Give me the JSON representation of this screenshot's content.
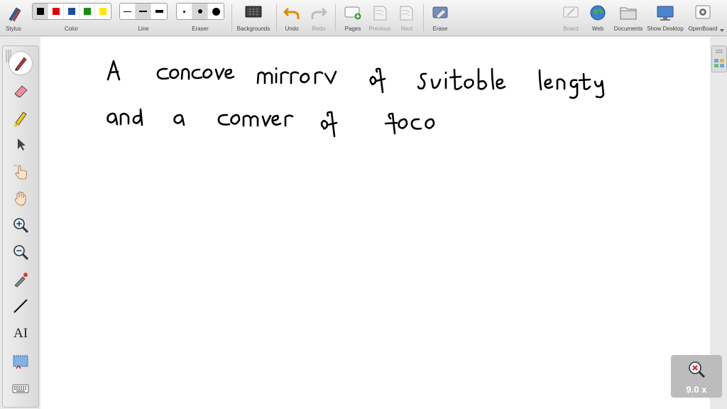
{
  "toolbar": {
    "stylus_label": "Stylus",
    "color_label": "Color",
    "line_label": "Line",
    "eraser_label": "Eraser",
    "backgrounds_label": "Backgrounds",
    "undo_label": "Undo",
    "redo_label": "Redo",
    "pages_label": "Pages",
    "previous_label": "Previous",
    "next_label": "Next",
    "erase_label": "Erase",
    "board_label": "Board",
    "web_label": "Web",
    "documents_label": "Documents",
    "show_desktop_label": "Show Desktop",
    "openboard_label": "OpenBoard",
    "colors": [
      "#000000",
      "#e00000",
      "#1a4fa0",
      "#119011",
      "#ffe800"
    ],
    "selected_color": "#000000",
    "selected_line": "medium",
    "selected_eraser": "medium"
  },
  "sidebar": {
    "tools": [
      "pen-icon",
      "eraser-icon",
      "marker-icon",
      "selector-icon",
      "interact-icon",
      "hand-icon",
      "zoom-in-icon",
      "zoom-out-icon",
      "laser-pointer-icon",
      "line-icon",
      "text-icon",
      "capture-icon",
      "keyboard-icon"
    ],
    "active_tool": "pen-icon",
    "text_tool_glyph": "AI"
  },
  "zoom": {
    "value": "9.0 x"
  },
  "canvas": {
    "background": "#ffffff",
    "ink_color": "#000000"
  }
}
